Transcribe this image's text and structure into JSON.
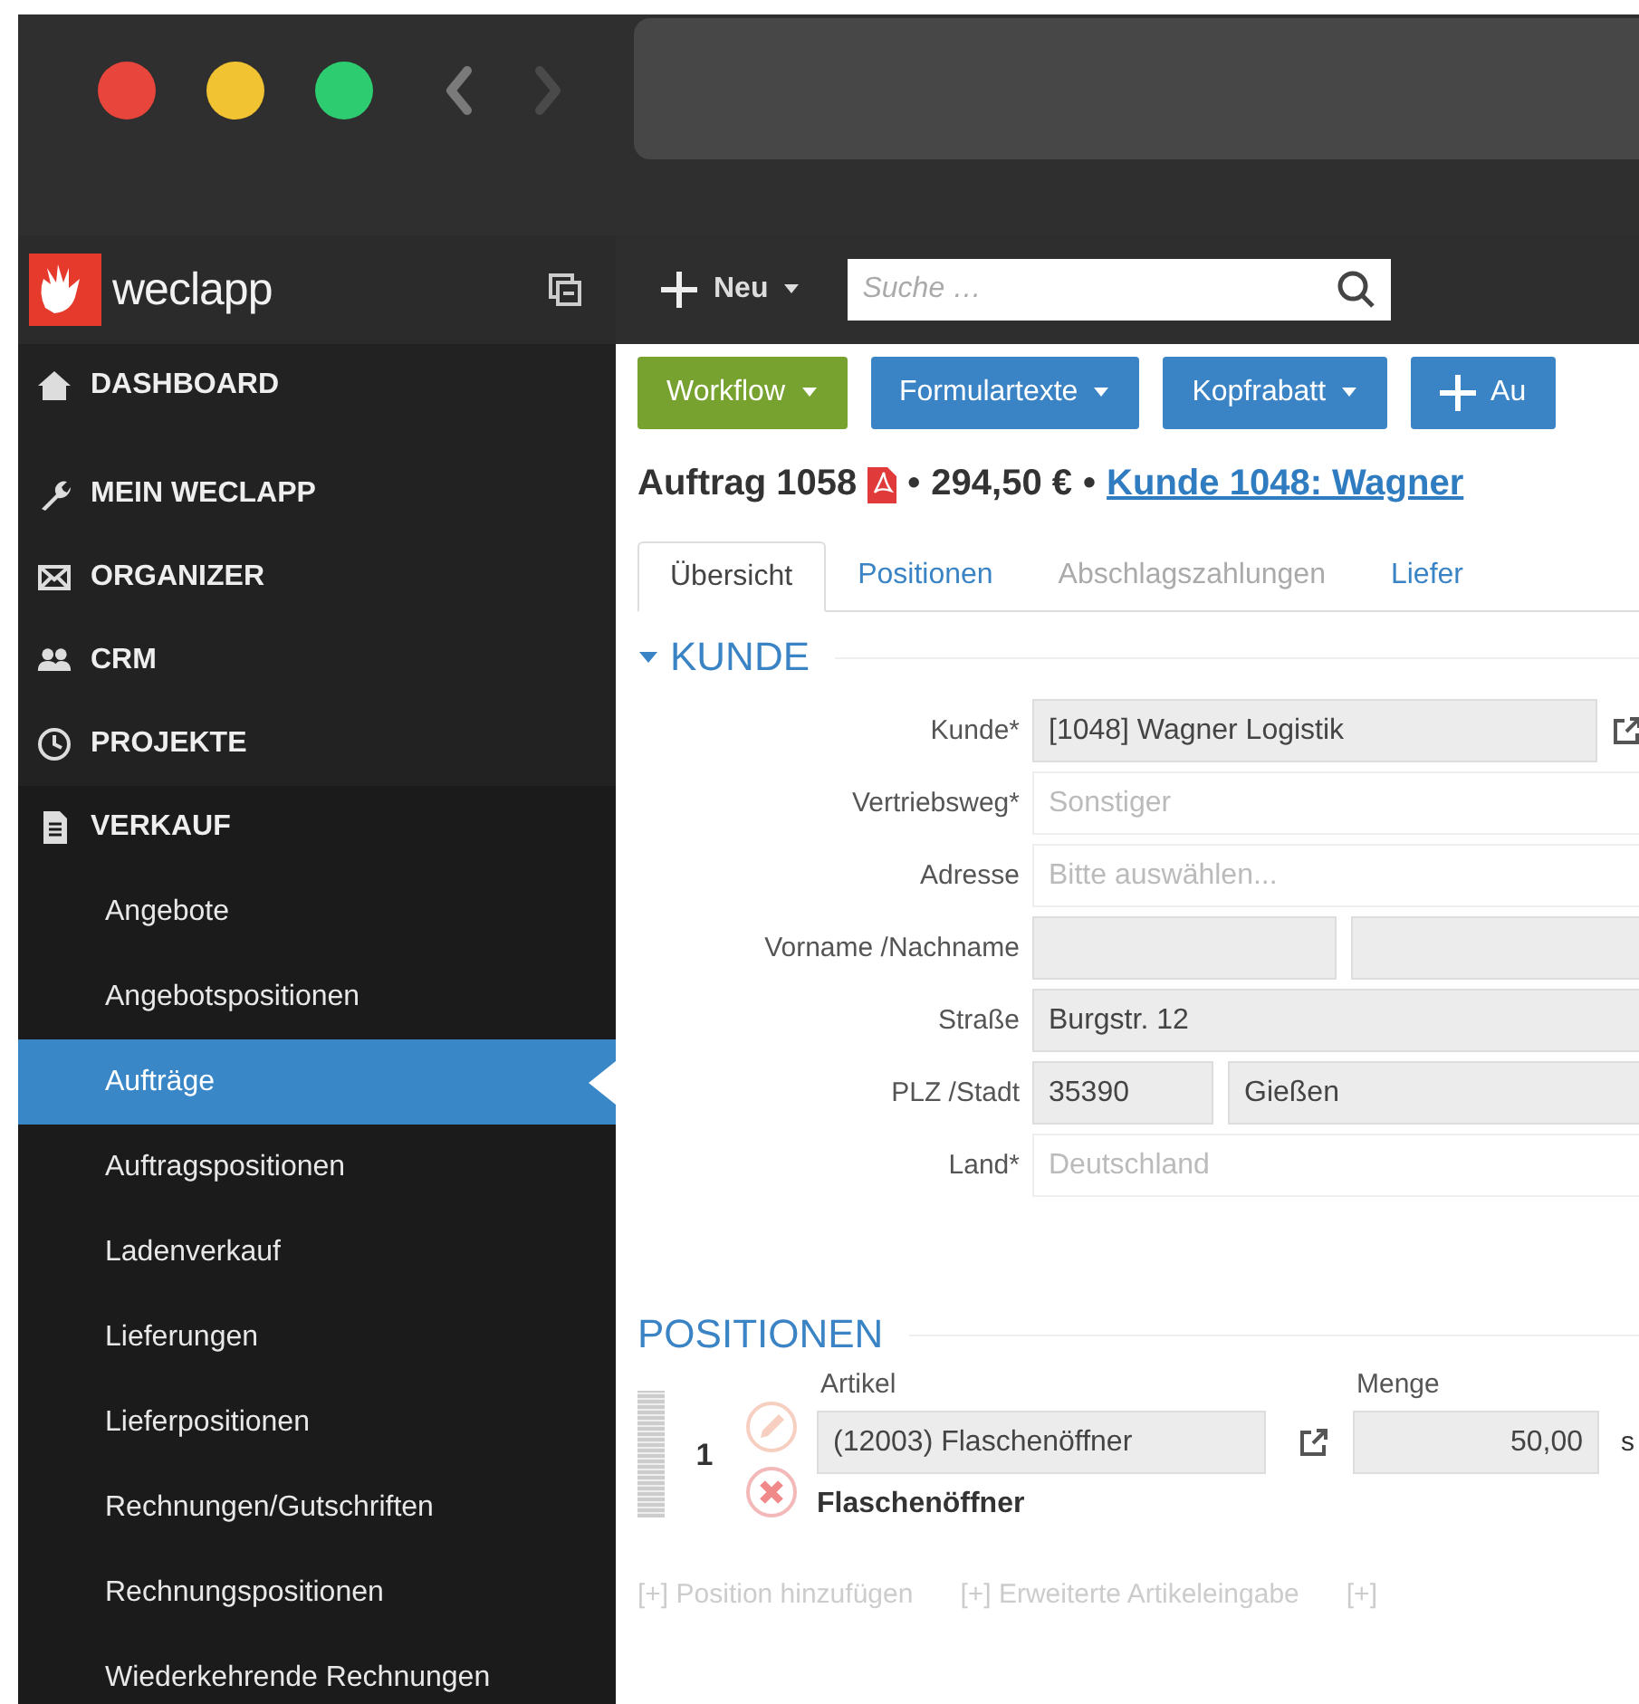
{
  "browser": {
    "window_buttons": [
      {
        "color": "#e8453c"
      },
      {
        "color": "#f1c232"
      },
      {
        "color": "#2ecc71"
      }
    ],
    "navigation": [
      {
        "kind": "back",
        "disabled": false
      },
      {
        "kind": "forward",
        "disabled": true
      }
    ]
  },
  "app": {
    "logo": "weclapp"
  },
  "sidebar": {
    "items": [
      {
        "label": "DASHBOARD"
      },
      {
        "label": "MEIN WECLAPP"
      },
      {
        "label": "ORGANIZER"
      },
      {
        "label": "CRM"
      },
      {
        "label": "PROJEKTE"
      },
      {
        "label": "VERKAUF",
        "children": [
          {
            "label": "Angebote",
            "selected": false
          },
          {
            "label": "Angebotspositionen",
            "selected": false
          },
          {
            "label": "Aufträge",
            "selected": true
          },
          {
            "label": "Auftragspositionen",
            "selected": false
          },
          {
            "label": "Ladenverkauf",
            "selected": false
          },
          {
            "label": "Lieferungen",
            "selected": false
          },
          {
            "label": "Lieferpositionen",
            "selected": false
          },
          {
            "label": "Rechnungen/Gutschriften",
            "selected": false
          },
          {
            "label": "Rechnungspositionen",
            "selected": false
          },
          {
            "label": "Wiederkehrende Rechnungen",
            "selected": false
          }
        ]
      }
    ]
  },
  "toolbar": {
    "new_label": "Neu",
    "search": {
      "placeholder": "Suche …"
    }
  },
  "actions": [
    {
      "label": "Workflow",
      "kind": "dropdown",
      "color": "#77a22f"
    },
    {
      "label": "Formulartexte",
      "kind": "dropdown",
      "color": "#3a84c5"
    },
    {
      "label": "Kopfrabatt",
      "kind": "dropdown",
      "color": "#3a84c5"
    },
    {
      "label": "Au",
      "kind": "add",
      "color": "#3a84c5"
    }
  ],
  "header": {
    "title": "Auftrag 1058",
    "separator_1": "•",
    "amount": "294,50 €",
    "separator_2": "•",
    "customer_link": "Kunde 1048: Wagner"
  },
  "tabs": [
    {
      "label": "Übersicht",
      "selected": true,
      "disabled": false
    },
    {
      "label": "Positionen",
      "selected": false,
      "disabled": false
    },
    {
      "label": "Abschlagszahlungen",
      "selected": false,
      "disabled": true
    },
    {
      "label": "Liefer",
      "selected": false,
      "disabled": false
    }
  ],
  "customer_section": {
    "title": "KUNDE",
    "expanded": true,
    "fields": [
      {
        "label": "Kunde*",
        "kind": "lookup",
        "inputs": [
          {
            "value": "[1048] Wagner Logistik"
          }
        ]
      },
      {
        "label": "Vertriebsweg*",
        "kind": "readonly_select",
        "inputs": [
          {
            "value": "Sonstiger"
          }
        ]
      },
      {
        "label": "Adresse",
        "kind": "select",
        "inputs": [
          {
            "placeholder": "Bitte auswählen..."
          }
        ]
      },
      {
        "label": "Vorname /Nachname",
        "kind": "empty_pair"
      },
      {
        "label": "Straße",
        "kind": "text",
        "inputs": [
          {
            "value": "Burgstr. 12"
          }
        ]
      },
      {
        "label": "PLZ /Stadt",
        "kind": "pair",
        "inputs": [
          {
            "value": "35390"
          },
          {
            "value": "Gießen"
          }
        ]
      },
      {
        "label": "Land*",
        "kind": "readonly_select",
        "inputs": [
          {
            "value": "Deutschland"
          }
        ]
      }
    ]
  },
  "positions_section": {
    "title": "POSITIONEN",
    "columns": [
      "Artikel",
      "Menge"
    ],
    "rows": [
      {
        "number": "1",
        "article": "(12003) Flaschenöffner",
        "quantity": "50,00",
        "unit": "s",
        "description": "Flaschenöffner"
      }
    ],
    "links": [
      "[+] Position hinzufügen",
      "[+] Erweiterte Artikeleingabe",
      "[+]"
    ]
  }
}
